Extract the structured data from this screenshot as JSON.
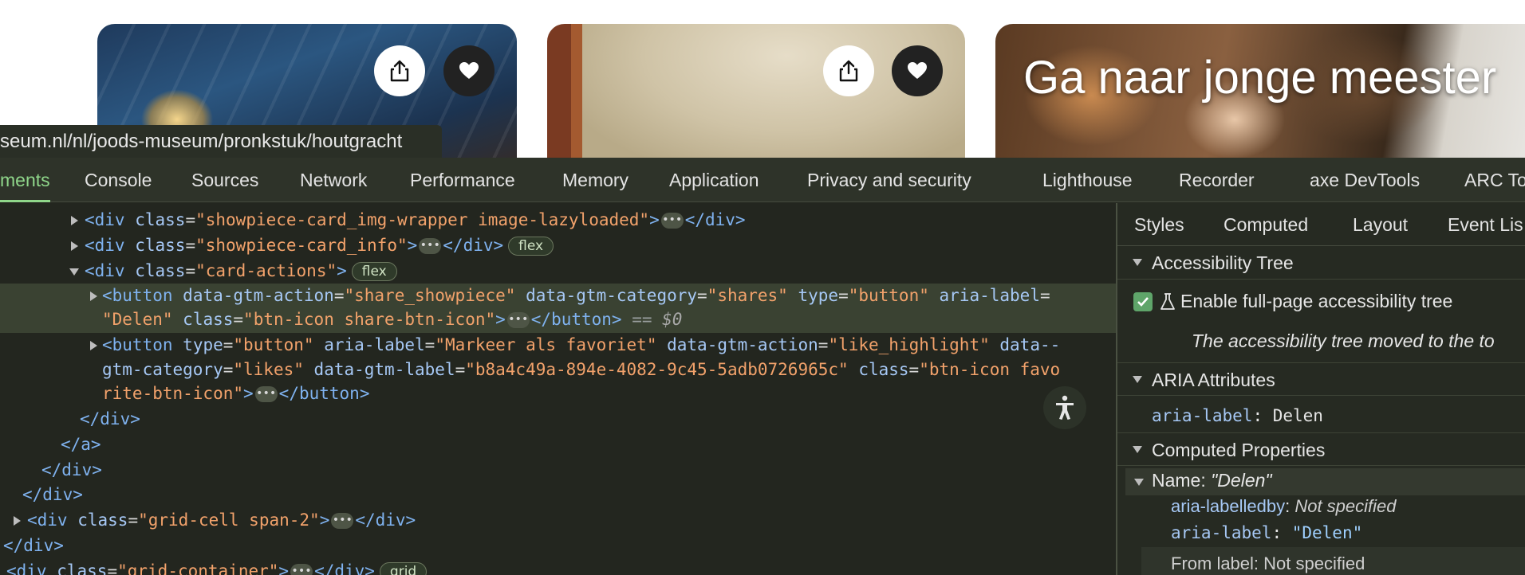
{
  "site": {
    "card3_title": "Ga naar jonge meester",
    "url_tooltip": "seum.nl/nl/joods-museum/pronkstuk/houtgracht"
  },
  "devtools": {
    "tabs": [
      "ments",
      "Console",
      "Sources",
      "Network",
      "Performance",
      "Memory",
      "Application",
      "Privacy and security",
      "Lighthouse",
      "Recorder",
      "axe DevTools",
      "ARC To"
    ],
    "dom": {
      "l0_open": "<div",
      "l0_attr": "class",
      "l0_val": "\"showpiece-card_img-wrapper image-lazyloaded\"",
      "l0_close": ">",
      "l0_end": "</div>",
      "l1_open": "<div",
      "l1_attr": "class",
      "l1_val": "\"showpiece-card_info\"",
      "l1_close": ">",
      "l1_end": "</div>",
      "l1_badge": "flex",
      "l2_open": "<div",
      "l2_attr": "class",
      "l2_val": "\"card-actions\"",
      "l2_close": ">",
      "l2_badge": "flex",
      "l3_open": "<button",
      "l3_a1": "data-gtm-action",
      "l3_v1": "\"share_showpiece\"",
      "l3_a2": "data-gtm-category",
      "l3_v2": "\"shares\"",
      "l3_a3": "type",
      "l3_v3": "\"button\"",
      "l3_a4": "aria-label",
      "l4_v4": "\"Delen\"",
      "l4_a5": "class",
      "l4_v5": "\"btn-icon share-btn-icon\"",
      "l4_close": ">",
      "l4_end": "</button>",
      "l4_eq": " == ",
      "l4_dollar": "$0",
      "l5_open": "<button",
      "l5_a1": "type",
      "l5_v1": "\"button\"",
      "l5_a2": "aria-label",
      "l5_v2": "\"Markeer als favoriet\"",
      "l5_a3": "data-gtm-action",
      "l5_v3": "\"like_highlight\"",
      "l5_a4": "data--",
      "l6_a4b": "gtm-category",
      "l6_v4": "\"likes\"",
      "l6_a5": "data-gtm-label",
      "l6_v5": "\"b8a4c49a-894e-4082-9c45-5adb0726965c\"",
      "l6_a6": "class",
      "l6_v6": "\"btn-icon favo",
      "l7_v6b": "rite-btn-icon\"",
      "l7_close": ">",
      "l7_end": "</button>",
      "l8": "</div>",
      "l9": "</a>",
      "l10": "</div>",
      "l11": "</div>",
      "l12_open": "<div",
      "l12_attr": "class",
      "l12_val": "\"grid-cell span-2\"",
      "l12_close": ">",
      "l12_end": "</div>",
      "l13": "</div>",
      "l14_open": "<div",
      "l14_attr": "class",
      "l14_val": "\"grid-container\"",
      "l14_close": ">",
      "l14_end": "</div>",
      "l14_badge": "grid"
    },
    "side_tabs": [
      "Styles",
      "Computed",
      "Layout",
      "Event Lis"
    ],
    "accessibility": {
      "tree_header": "Accessibility Tree",
      "enable_label": "Enable full-page accessibility tree",
      "moved_note": "The accessibility tree moved to the to",
      "aria_header": "ARIA Attributes",
      "aria_label_key": "aria-label",
      "aria_label_value": "Delen",
      "computed_header": "Computed Properties",
      "name_key": "Name: ",
      "name_value": "\"Delen\"",
      "labelledby_key": "aria-labelledby",
      "labelledby_value": "Not specified",
      "label_key": "aria-label",
      "label_value": "\"Delen\"",
      "cut_row": "From label: Not specified"
    }
  }
}
